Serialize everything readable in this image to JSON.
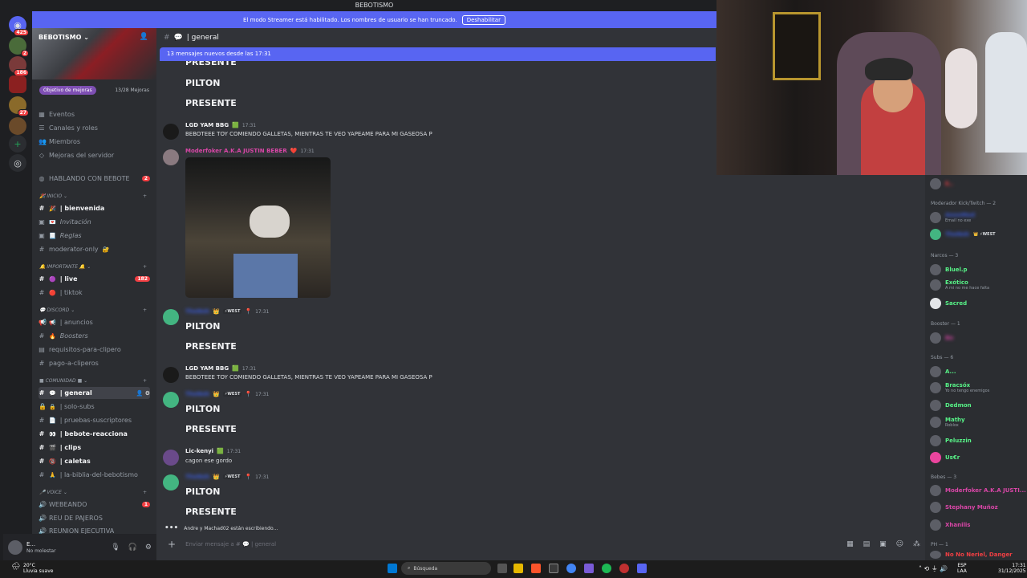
{
  "window": {
    "title": "BEBOTISMO"
  },
  "streamer_banner": {
    "text": "El modo Streamer está habilitado. Los nombres de usuario se han truncado.",
    "button": "Deshabilitar"
  },
  "guilds": {
    "top_badge": "425",
    "badges": [
      "2",
      "186",
      "27"
    ]
  },
  "server": {
    "name": "BEBOTISMO",
    "boost_goal": "Objetivo de mejoras",
    "boost_count": "13/28 Mejoras"
  },
  "sidebar_top": [
    "Eventos",
    "Canales y roles",
    "Miembros",
    "Mejoras del servidor"
  ],
  "hablando": {
    "label": "HABLANDO CON BEBOTE",
    "badge": "2"
  },
  "categories": {
    "inicio": "INICIO",
    "importante": "IMPORTANTE",
    "discord": "DISCORD",
    "comunidad": "COMUNIDAD",
    "voice": "VOICE"
  },
  "channels": {
    "bienvenida": "| bienvenida",
    "invitacion": "Invitación",
    "reglas": "Reglas",
    "moderator": "moderator-only",
    "live": "| live",
    "live_badge": "182",
    "tiktok": "| tiktok",
    "anuncios": "| anuncios",
    "boosters": "Boosters",
    "requisitos": "requisitos-para-clipero",
    "pago": "pago-a-cliperos",
    "general": "| general",
    "solo_subs": "| solo-subs",
    "pruebas": "| pruebas-suscriptores",
    "bebote": "| bebote-reacciona",
    "clips": "| clips",
    "caletas": "| caletas",
    "biblia": "| la-biblia-del-bebotismo",
    "webeando": "WEBEANDO",
    "webeando_badge": "1",
    "reu": "REU DE PAJEROS",
    "reunion": "REUNION EJECUTIVA"
  },
  "user": {
    "name": "E...",
    "status": "No molestar"
  },
  "channel_header": "| general",
  "new_messages": "13 mensajes nuevos desde las 17:31",
  "messages": {
    "presente": "PRESENTE",
    "pilton": "PILTON",
    "lgd_name": "LGD YAM BBG",
    "time": "17:31",
    "lgd_text": "BEBOTEEE TOY COMIENDO GALLETAS, MIENTRAS TE VEO YAPEAME PARA MI GASEOSA P",
    "mod_name": "Moderfoker A.K.A JUSTIN BEBER",
    "west": "WEST",
    "lic_name": "Lic-kenyi",
    "lic_text": "cagon ese gordo"
  },
  "typing": "Andre y Machad02 están escribiendo...",
  "input_placeholder": "Enviar mensaje a #",
  "input_channel": "| general",
  "members": {
    "cat_mod": "Moderador Kick/Twitch — 2",
    "mod1_sub": "Email no exe",
    "cat_narcos": "Narcos — 3",
    "narcos": [
      "Bluel.p",
      "Exótico",
      "Sacred"
    ],
    "exotico_sub": "A mi no me hace falta",
    "cat_booster": "Booster — 1",
    "cat_subs": "Subs — 6",
    "subs": [
      "A...",
      "Bracsóx",
      "Dedmon",
      "Mathy",
      "Peluzzin",
      "Us€r"
    ],
    "bracsox_sub": "Yo no tengo enemigos",
    "mathy_sub": "Roblox",
    "cat_bebes": "Bebes — 3",
    "bebes": [
      "Moderfoker A.K.A JUSTI...",
      "Stephany Muñoz",
      "Xhanilis"
    ],
    "cat_ph": "PH — 1",
    "ph1": "No No Neriel, Danger"
  },
  "taskbar": {
    "weather_temp": "20°C",
    "weather_desc": "Lluvia suave",
    "search": "Búsqueda",
    "lang": "ESP",
    "lang2": "LAA",
    "time": "17:31",
    "date": "31/12/2025"
  },
  "colors": {
    "blurple": "#5865f2",
    "mod_pink": "#d946a7",
    "green": "#57f287",
    "blue_name": "#3b5bdb",
    "red": "#f23f43"
  }
}
